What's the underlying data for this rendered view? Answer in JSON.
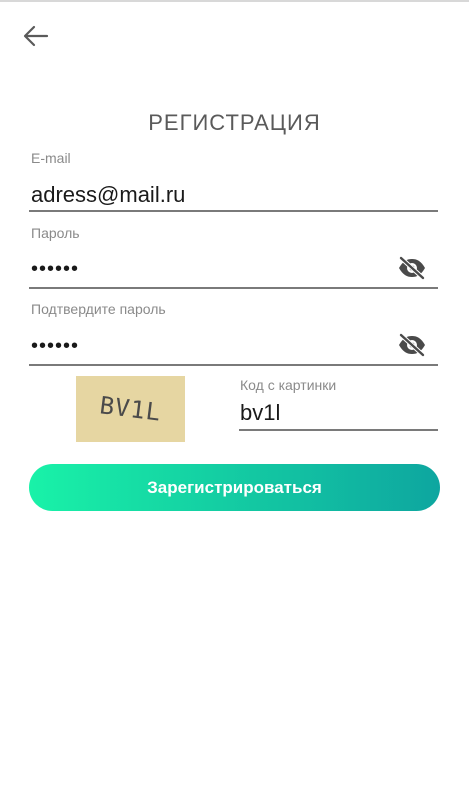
{
  "header": {
    "back_icon": "arrow-left-icon"
  },
  "page": {
    "title": "РЕГИСТРАЦИЯ"
  },
  "form": {
    "email": {
      "label": "E-mail",
      "value": "adress@mail.ru"
    },
    "password": {
      "label": "Пароль",
      "value": "••••••",
      "toggle_icon": "eye-off-icon"
    },
    "confirm_password": {
      "label": "Подтвердите пароль",
      "value": "••••••",
      "toggle_icon": "eye-off-icon"
    },
    "captcha": {
      "image_text": "BV1L",
      "label": "Код с картинки",
      "value": "bv1l"
    },
    "submit_label": "Зарегистрироваться"
  },
  "colors": {
    "button_gradient_start": "#19f2a8",
    "button_gradient_end": "#0ea6a0",
    "captcha_background": "#e6d6a2"
  }
}
